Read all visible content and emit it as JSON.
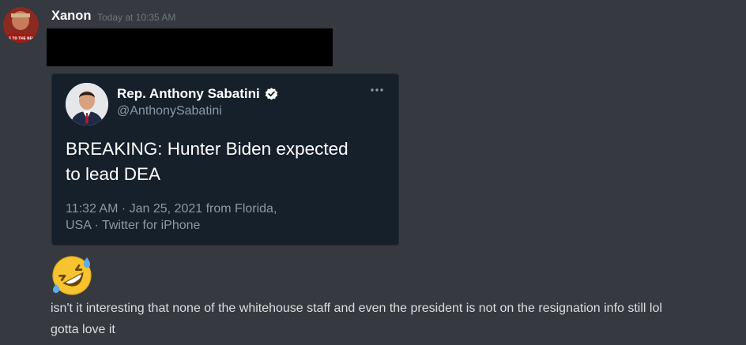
{
  "message": {
    "author": "Xanon",
    "timestamp": "Today at 10:35 AM",
    "avatar_text": "E TO THE REI",
    "lines": [
      "isn't it interesting that none of the whitehouse staff and even the president is not on the resignation info still lol",
      "gotta love it"
    ],
    "emoji": "rolling-on-the-floor-laughing-icon"
  },
  "tweet": {
    "name": "Rep. Anthony Sabatini",
    "handle": "@AnthonySabatini",
    "text_lines": [
      "BREAKING: Hunter Biden expected",
      "to lead DEA"
    ],
    "meta_line1": "11:32 AM · Jan 25, 2021 from Florida,",
    "meta_line2": "USA · Twitter for iPhone"
  },
  "colors": {
    "background": "#36393f",
    "tweet_background": "#15202b",
    "muted": "#72767d",
    "tweet_muted": "#8b98a5",
    "message_text": "#dcddde"
  }
}
